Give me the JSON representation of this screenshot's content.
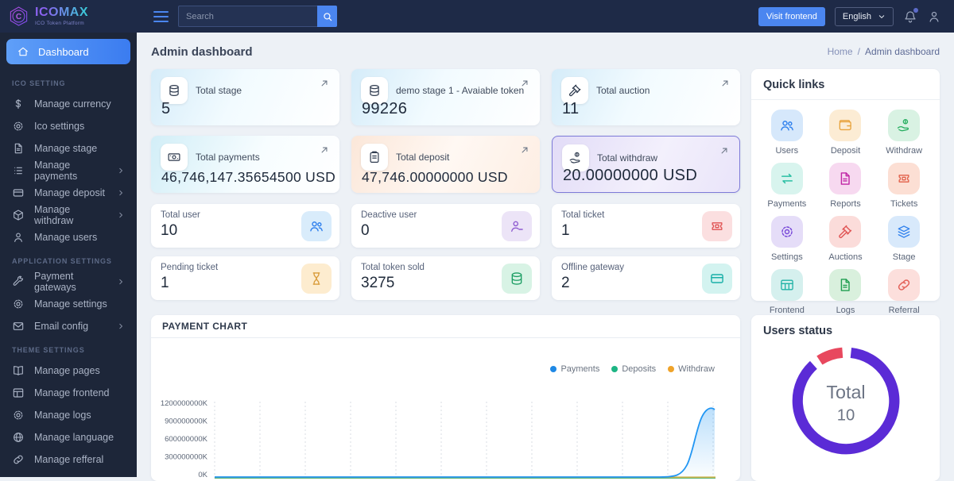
{
  "topbar": {
    "brand": "ICOMAX",
    "brand_sub": "ICO Token Platform",
    "search_placeholder": "Search",
    "visit_frontend": "Visit frontend",
    "language": "English"
  },
  "page_title": "Admin dashboard",
  "breadcrumb": {
    "home": "Home",
    "sep": "/",
    "current": "Admin dashboard"
  },
  "sidebar": {
    "active": "Dashboard",
    "section1": "ICO SETTING",
    "items1": [
      "Manage currency",
      "Ico settings",
      "Manage stage",
      "Manage payments",
      "Manage deposit",
      "Manage withdraw",
      "Manage users"
    ],
    "section2": "APPLICATION SETTINGS",
    "items2": [
      "Payment gateways",
      "Manage settings",
      "Email config"
    ],
    "section3": "THEME SETTINGS",
    "items3": [
      "Manage pages",
      "Manage frontend",
      "Manage logs",
      "Manage language",
      "Manage refferal"
    ]
  },
  "cards": {
    "row1": [
      {
        "label": "Total stage",
        "value": "5",
        "icon": "coins-icon"
      },
      {
        "label": "demo stage 1 - Avaiable token",
        "value": "99226",
        "icon": "coins-icon"
      },
      {
        "label": "Total auction",
        "value": "11",
        "icon": "gavel-icon"
      }
    ],
    "row2": [
      {
        "label": "Total payments",
        "value": "46,746,147.35654500 USD",
        "icon": "cash-icon"
      },
      {
        "label": "Total deposit",
        "value": "47,746.00000000 USD",
        "icon": "clipboard-icon"
      },
      {
        "label": "Total withdraw",
        "value": "20.00000000 USD",
        "icon": "hand-dollar-icon"
      }
    ],
    "small": [
      {
        "label": "Total user",
        "value": "10",
        "icon": "users-icon"
      },
      {
        "label": "Deactive user",
        "value": "0",
        "icon": "user-minus-icon"
      },
      {
        "label": "Total ticket",
        "value": "1",
        "icon": "ticket-icon"
      },
      {
        "label": "Pending ticket",
        "value": "1",
        "icon": "hourglass-icon"
      },
      {
        "label": "Total token sold",
        "value": "3275",
        "icon": "coins-icon"
      },
      {
        "label": "Offline gateway",
        "value": "2",
        "icon": "card-icon"
      }
    ]
  },
  "quick_links": {
    "title": "Quick links",
    "items": [
      "Users",
      "Deposit",
      "Withdraw",
      "Payments",
      "Reports",
      "Tickets",
      "Settings",
      "Auctions",
      "Stage",
      "Frontend",
      "Logs",
      "Referral"
    ]
  },
  "payment_chart": {
    "title": "PAYMENT CHART",
    "legend": [
      "Payments",
      "Deposits",
      "Withdraw"
    ],
    "yticks": [
      "1200000000K",
      "900000000K",
      "600000000K",
      "300000000K",
      "0K"
    ]
  },
  "users_status": {
    "title": "Users status",
    "center_label": "Total",
    "center_value": "10"
  },
  "colors": {
    "topbar_bg": "#1e2a47",
    "sidebar_bg": "#1d2639",
    "accent_blue": "#4b86f0",
    "payments_line": "#1e88e5",
    "deposits_line": "#1db584",
    "withdraw_line": "#c9b44e",
    "donut_purple": "#5b2bd6",
    "donut_red": "#e8485e"
  },
  "chart_data": [
    {
      "type": "line",
      "title": "PAYMENT CHART",
      "legend_position": "top-right",
      "grid": "vertical-dashed",
      "x_labels_visible": false,
      "ylim": [
        0,
        1200000000
      ],
      "yticks": [
        "0K",
        "300000000K",
        "600000000K",
        "900000000K",
        "1200000000K"
      ],
      "series": [
        {
          "name": "Payments",
          "color": "#1e88e5",
          "approx_values_K": [
            0,
            0,
            0,
            0,
            0,
            0,
            0,
            0,
            0,
            0,
            60000000,
            1080000000
          ]
        },
        {
          "name": "Deposits",
          "color": "#1db584",
          "approx_values_K": [
            0,
            0,
            0,
            0,
            0,
            0,
            0,
            0,
            0,
            0,
            0,
            0
          ]
        },
        {
          "name": "Withdraw",
          "color": "#efa32a",
          "approx_values_K": [
            0,
            0,
            0,
            0,
            0,
            0,
            0,
            0,
            0,
            0,
            0,
            0
          ]
        }
      ]
    },
    {
      "type": "donut",
      "title": "Users status",
      "center_label": "Total",
      "total": 10,
      "segments": [
        {
          "color": "#5b2bd6",
          "value": 9
        },
        {
          "color": "#e8485e",
          "value": 1
        }
      ]
    }
  ]
}
